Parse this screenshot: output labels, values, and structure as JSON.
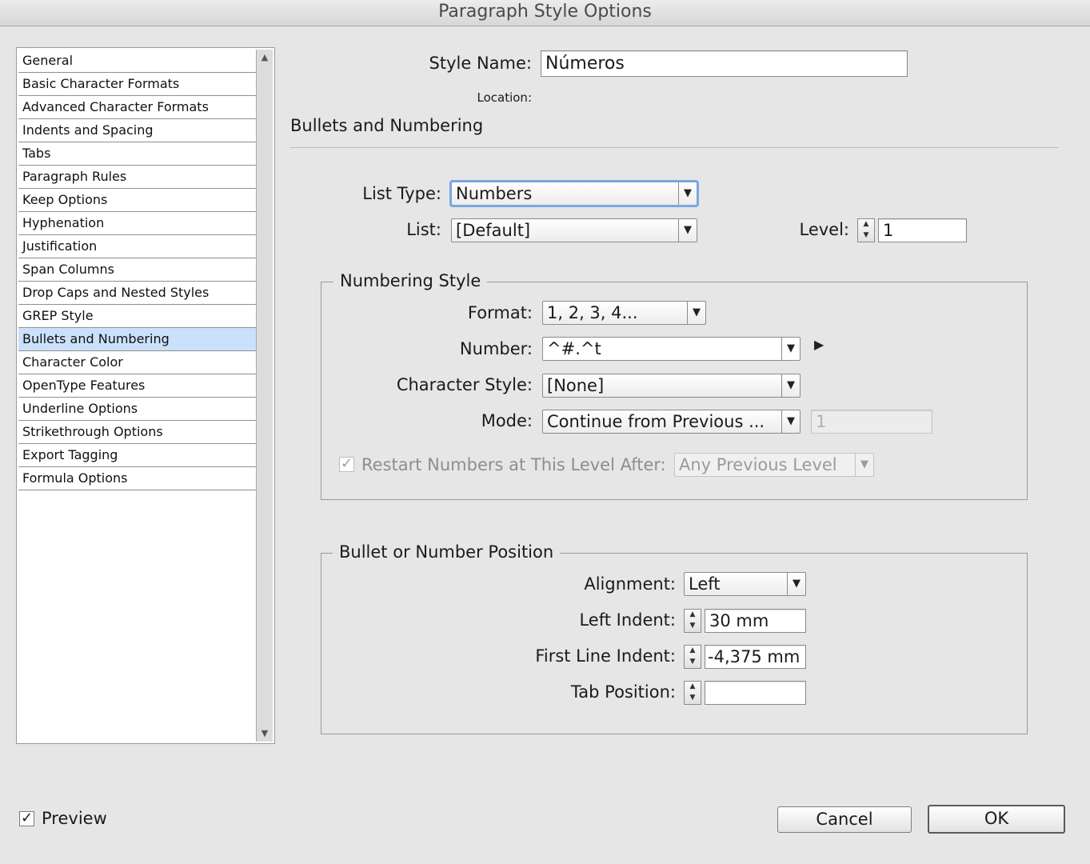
{
  "window": {
    "title": "Paragraph Style Options"
  },
  "sidebar": {
    "items": [
      {
        "label": "General"
      },
      {
        "label": "Basic Character Formats"
      },
      {
        "label": "Advanced Character Formats"
      },
      {
        "label": "Indents and Spacing"
      },
      {
        "label": "Tabs"
      },
      {
        "label": "Paragraph Rules"
      },
      {
        "label": "Keep Options"
      },
      {
        "label": "Hyphenation"
      },
      {
        "label": "Justification"
      },
      {
        "label": "Span Columns"
      },
      {
        "label": "Drop Caps and Nested Styles"
      },
      {
        "label": "GREP Style"
      },
      {
        "label": "Bullets and Numbering",
        "selected": true
      },
      {
        "label": "Character Color"
      },
      {
        "label": "OpenType Features"
      },
      {
        "label": "Underline Options"
      },
      {
        "label": "Strikethrough Options"
      },
      {
        "label": "Export Tagging"
      },
      {
        "label": "Formula Options"
      }
    ],
    "scroll_up_icon": "triangle-up-icon",
    "scroll_down_icon": "triangle-down-icon"
  },
  "header": {
    "style_name_label": "Style Name:",
    "style_name_value": "Números",
    "location_label": "Location:",
    "section_title": "Bullets and Numbering"
  },
  "list": {
    "list_type_label": "List Type:",
    "list_type_value": "Numbers",
    "list_label": "List:",
    "list_value": "[Default]",
    "level_label": "Level:",
    "level_value": "1"
  },
  "numbering_style": {
    "legend": "Numbering Style",
    "format_label": "Format:",
    "format_value": "1, 2, 3, 4...",
    "number_label": "Number:",
    "number_value": "^#.^t",
    "character_style_label": "Character Style:",
    "character_style_value": "[None]",
    "mode_label": "Mode:",
    "mode_value": "Continue from Previous ...",
    "mode_start_value": "1",
    "restart_label": "Restart Numbers at This Level After:",
    "restart_checked": true,
    "restart_value": "Any Previous Level"
  },
  "position": {
    "legend": "Bullet or Number Position",
    "alignment_label": "Alignment:",
    "alignment_value": "Left",
    "left_indent_label": "Left Indent:",
    "left_indent_value": "30 mm",
    "first_line_indent_label": "First Line Indent:",
    "first_line_indent_value": "-4,375 mm",
    "tab_position_label": "Tab Position:",
    "tab_position_value": ""
  },
  "footer": {
    "preview_label": "Preview",
    "preview_checked": true,
    "cancel_label": "Cancel",
    "ok_label": "OK"
  },
  "glyphs": {
    "dropdown_arrow": "▼",
    "spin_up": "▲",
    "spin_down": "▼",
    "check": "✓",
    "disclosure": "▶"
  },
  "colors": {
    "selection": "#cbe1fb",
    "focus_ring": "#7aa7e0",
    "dialog_bg": "#e6e6e6"
  }
}
